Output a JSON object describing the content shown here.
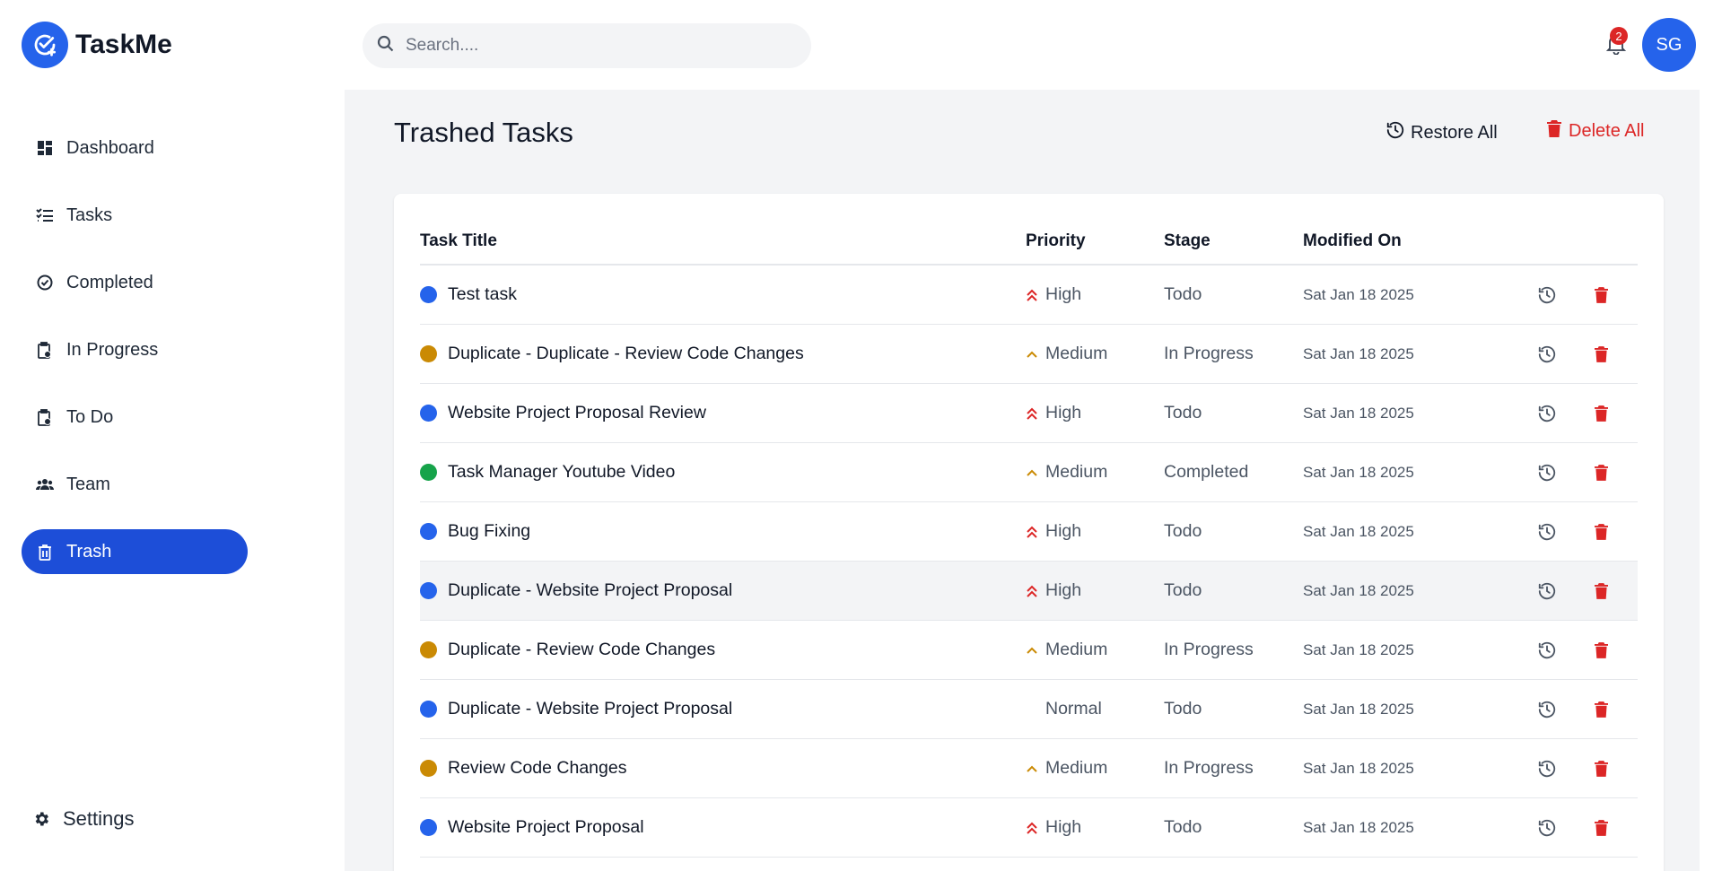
{
  "app": {
    "name": "TaskMe"
  },
  "colors": {
    "accent": "#2563eb",
    "danger": "#dc2626",
    "high": "#dc2626",
    "medium": "#ca8a04",
    "todo": "#2563eb",
    "in_progress": "#ca8a04",
    "completed": "#16a34a"
  },
  "search": {
    "placeholder": "Search...."
  },
  "notifications": {
    "count": "2"
  },
  "user": {
    "initials": "SG"
  },
  "sidebar": {
    "items": [
      {
        "label": "Dashboard",
        "icon": "dashboard-icon"
      },
      {
        "label": "Tasks",
        "icon": "tasks-list-icon"
      },
      {
        "label": "Completed",
        "icon": "check-circle-icon"
      },
      {
        "label": "In Progress",
        "icon": "clipboard-progress-icon"
      },
      {
        "label": "To Do",
        "icon": "clipboard-todo-icon"
      },
      {
        "label": "Team",
        "icon": "team-icon"
      },
      {
        "label": "Trash",
        "icon": "trash-icon",
        "active": true
      }
    ],
    "settings": "Settings"
  },
  "main": {
    "title": "Trashed Tasks",
    "restore_all": "Restore All",
    "delete_all": "Delete All",
    "columns": [
      "Task Title",
      "Priority",
      "Stage",
      "Modified On"
    ],
    "rows": [
      {
        "title": "Test task",
        "priority": "High",
        "stage": "Todo",
        "modified": "Sat Jan 18 2025"
      },
      {
        "title": "Duplicate - Duplicate - Review Code Changes",
        "priority": "Medium",
        "stage": "In Progress",
        "modified": "Sat Jan 18 2025"
      },
      {
        "title": "Website Project Proposal Review",
        "priority": "High",
        "stage": "Todo",
        "modified": "Sat Jan 18 2025"
      },
      {
        "title": "Task Manager Youtube Video",
        "priority": "Medium",
        "stage": "Completed",
        "modified": "Sat Jan 18 2025"
      },
      {
        "title": "Bug Fixing",
        "priority": "High",
        "stage": "Todo",
        "modified": "Sat Jan 18 2025"
      },
      {
        "title": "Duplicate - Website Project Proposal",
        "priority": "High",
        "stage": "Todo",
        "modified": "Sat Jan 18 2025"
      },
      {
        "title": "Duplicate - Review Code Changes",
        "priority": "Medium",
        "stage": "In Progress",
        "modified": "Sat Jan 18 2025"
      },
      {
        "title": "Duplicate - Website Project Proposal",
        "priority": "Normal",
        "stage": "Todo",
        "modified": "Sat Jan 18 2025"
      },
      {
        "title": "Review Code Changes",
        "priority": "Medium",
        "stage": "In Progress",
        "modified": "Sat Jan 18 2025"
      },
      {
        "title": "Website Project Proposal",
        "priority": "High",
        "stage": "Todo",
        "modified": "Sat Jan 18 2025"
      }
    ]
  }
}
